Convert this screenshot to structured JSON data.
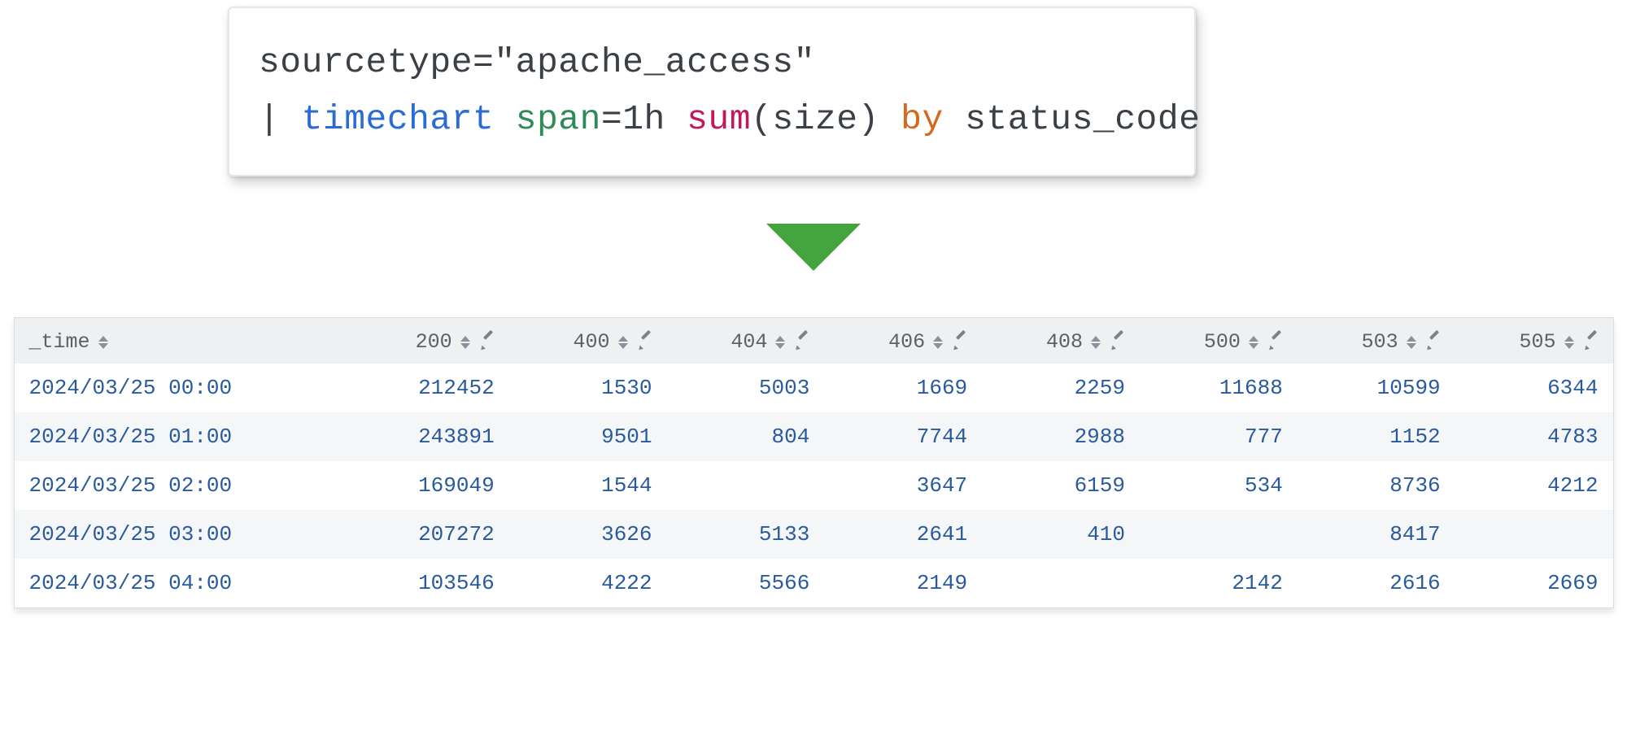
{
  "query": {
    "line1": {
      "full": "sourcetype=\"apache_access\""
    },
    "line2": {
      "pipe": "| ",
      "cmd": "timechart",
      "sp1": " ",
      "arg": "span",
      "argrest": "=1h ",
      "fn": "sum",
      "fnrest": "(size) ",
      "by": "by",
      "tail": " status_code"
    }
  },
  "table": {
    "time_header": "_time",
    "columns": [
      "200",
      "400",
      "404",
      "406",
      "408",
      "500",
      "503",
      "505"
    ],
    "rows": [
      {
        "time": "2024/03/25 00:00",
        "v": [
          "212452",
          "1530",
          "5003",
          "1669",
          "2259",
          "11688",
          "10599",
          "6344"
        ]
      },
      {
        "time": "2024/03/25 01:00",
        "v": [
          "243891",
          "9501",
          "804",
          "7744",
          "2988",
          "777",
          "1152",
          "4783"
        ]
      },
      {
        "time": "2024/03/25 02:00",
        "v": [
          "169049",
          "1544",
          "",
          "3647",
          "6159",
          "534",
          "8736",
          "4212"
        ]
      },
      {
        "time": "2024/03/25 03:00",
        "v": [
          "207272",
          "3626",
          "5133",
          "2641",
          "410",
          "",
          "8417",
          ""
        ]
      },
      {
        "time": "2024/03/25 04:00",
        "v": [
          "103546",
          "4222",
          "5566",
          "2149",
          "",
          "2142",
          "2616",
          "2669"
        ]
      }
    ]
  },
  "chart_data": {
    "type": "table",
    "title": "sum(size) by status_code per hour",
    "source_query": "sourcetype=\"apache_access\" | timechart span=1h sum(size) by status_code",
    "x_field": "_time",
    "categories": [
      "2024/03/25 00:00",
      "2024/03/25 01:00",
      "2024/03/25 02:00",
      "2024/03/25 03:00",
      "2024/03/25 04:00"
    ],
    "series": [
      {
        "name": "200",
        "values": [
          212452,
          243891,
          169049,
          207272,
          103546
        ]
      },
      {
        "name": "400",
        "values": [
          1530,
          9501,
          1544,
          3626,
          4222
        ]
      },
      {
        "name": "404",
        "values": [
          5003,
          804,
          null,
          5133,
          5566
        ]
      },
      {
        "name": "406",
        "values": [
          1669,
          7744,
          3647,
          2641,
          2149
        ]
      },
      {
        "name": "408",
        "values": [
          2259,
          2988,
          6159,
          410,
          null
        ]
      },
      {
        "name": "500",
        "values": [
          11688,
          777,
          534,
          null,
          2142
        ]
      },
      {
        "name": "503",
        "values": [
          10599,
          1152,
          8736,
          8417,
          2616
        ]
      },
      {
        "name": "505",
        "values": [
          6344,
          4783,
          4212,
          null,
          2669
        ]
      }
    ]
  }
}
